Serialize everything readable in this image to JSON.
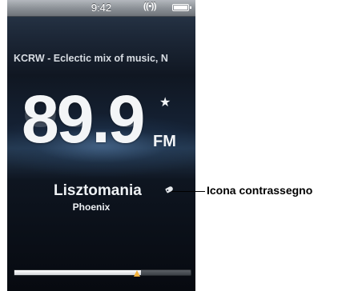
{
  "status_bar": {
    "time": "9:42",
    "signal_icon": "radio-signal-icon",
    "signal_glyph": "((•))",
    "battery_icon": "battery-icon"
  },
  "radio": {
    "station_text": "KCRW - Eclectic mix of music, N",
    "frequency": "89.9",
    "band": "FM",
    "favorite_icon": "star-icon",
    "favorite_glyph": "★",
    "song_title": "Lisztomania",
    "artist": "Phoenix",
    "tag_icon": "tag-icon",
    "tuner_position_fraction": 0.72
  },
  "callout": {
    "label": "Icona contrassegno"
  },
  "colors": {
    "indicator": "#f4b13b"
  }
}
